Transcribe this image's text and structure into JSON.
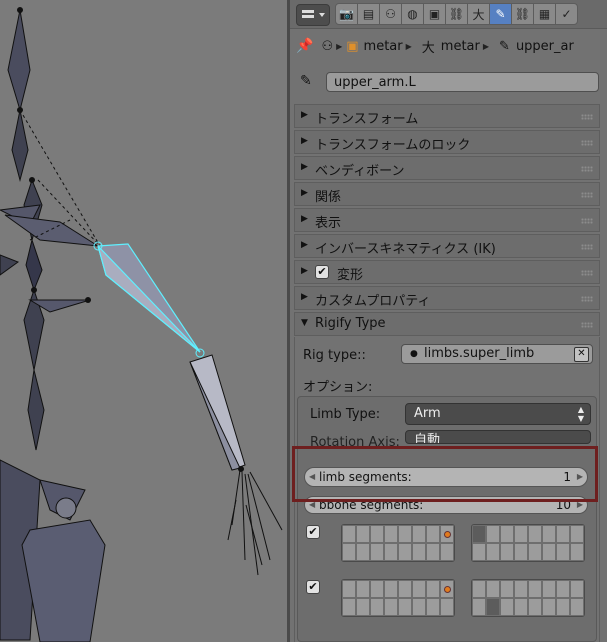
{
  "colors": {
    "accent": "#5680c2",
    "selection": "#5ff0ff",
    "highlight": "#6e1f1f"
  },
  "header": {
    "editor_icon": "properties-editor-icon",
    "context_tabs": [
      {
        "name": "render-icon",
        "glyph": "📷",
        "active": false
      },
      {
        "name": "render-layers-icon",
        "glyph": "▤",
        "active": false
      },
      {
        "name": "scene-icon",
        "glyph": "⚇",
        "active": false
      },
      {
        "name": "world-icon",
        "glyph": "◍",
        "active": false
      },
      {
        "name": "object-icon",
        "glyph": "▣",
        "active": false
      },
      {
        "name": "constraints-icon",
        "glyph": "⛓",
        "active": false
      },
      {
        "name": "armature-data-icon",
        "glyph": "⼤",
        "active": false
      },
      {
        "name": "bone-icon",
        "glyph": "✎",
        "active": true
      },
      {
        "name": "bone-constraints-icon",
        "glyph": "⛓",
        "active": false
      },
      {
        "name": "texture-icon",
        "glyph": "▦",
        "active": false
      },
      {
        "name": "more-icon",
        "glyph": "✓",
        "active": false
      }
    ]
  },
  "breadcrumb": {
    "object": "metar",
    "armature": "metar",
    "bone": "upper_ar"
  },
  "bone_name": "upper_arm.L",
  "panels": [
    {
      "label": "トランスフォーム",
      "checkbox": false,
      "open": false
    },
    {
      "label": "トランスフォームのロック",
      "checkbox": false,
      "open": false
    },
    {
      "label": "ベンディボーン",
      "checkbox": false,
      "open": false
    },
    {
      "label": "関係",
      "checkbox": false,
      "open": false
    },
    {
      "label": "表示",
      "checkbox": false,
      "open": false
    },
    {
      "label": "インバースキネマティクス (IK)",
      "checkbox": false,
      "open": false
    },
    {
      "label": "変形",
      "checkbox": true,
      "open": false
    },
    {
      "label": "カスタムプロパティ",
      "checkbox": false,
      "open": false
    },
    {
      "label": "Rigify Type",
      "checkbox": false,
      "open": true
    }
  ],
  "rigify": {
    "rig_type_label": "Rig type::",
    "rig_type_value": "limbs.super_limb",
    "options_label": "オプション:",
    "limb_type_label": "Limb Type:",
    "limb_type_value": "Arm",
    "rotation_axis_label": "Rotation Axis:",
    "rotation_axis_value": "自動",
    "limb_segments_label": "limb segments:",
    "limb_segments_value": "1",
    "bbone_segments_label": "bbone segments:",
    "bbone_segments_value": "10",
    "layer_rows": [
      {
        "checked": true
      },
      {
        "checked": true
      }
    ]
  }
}
